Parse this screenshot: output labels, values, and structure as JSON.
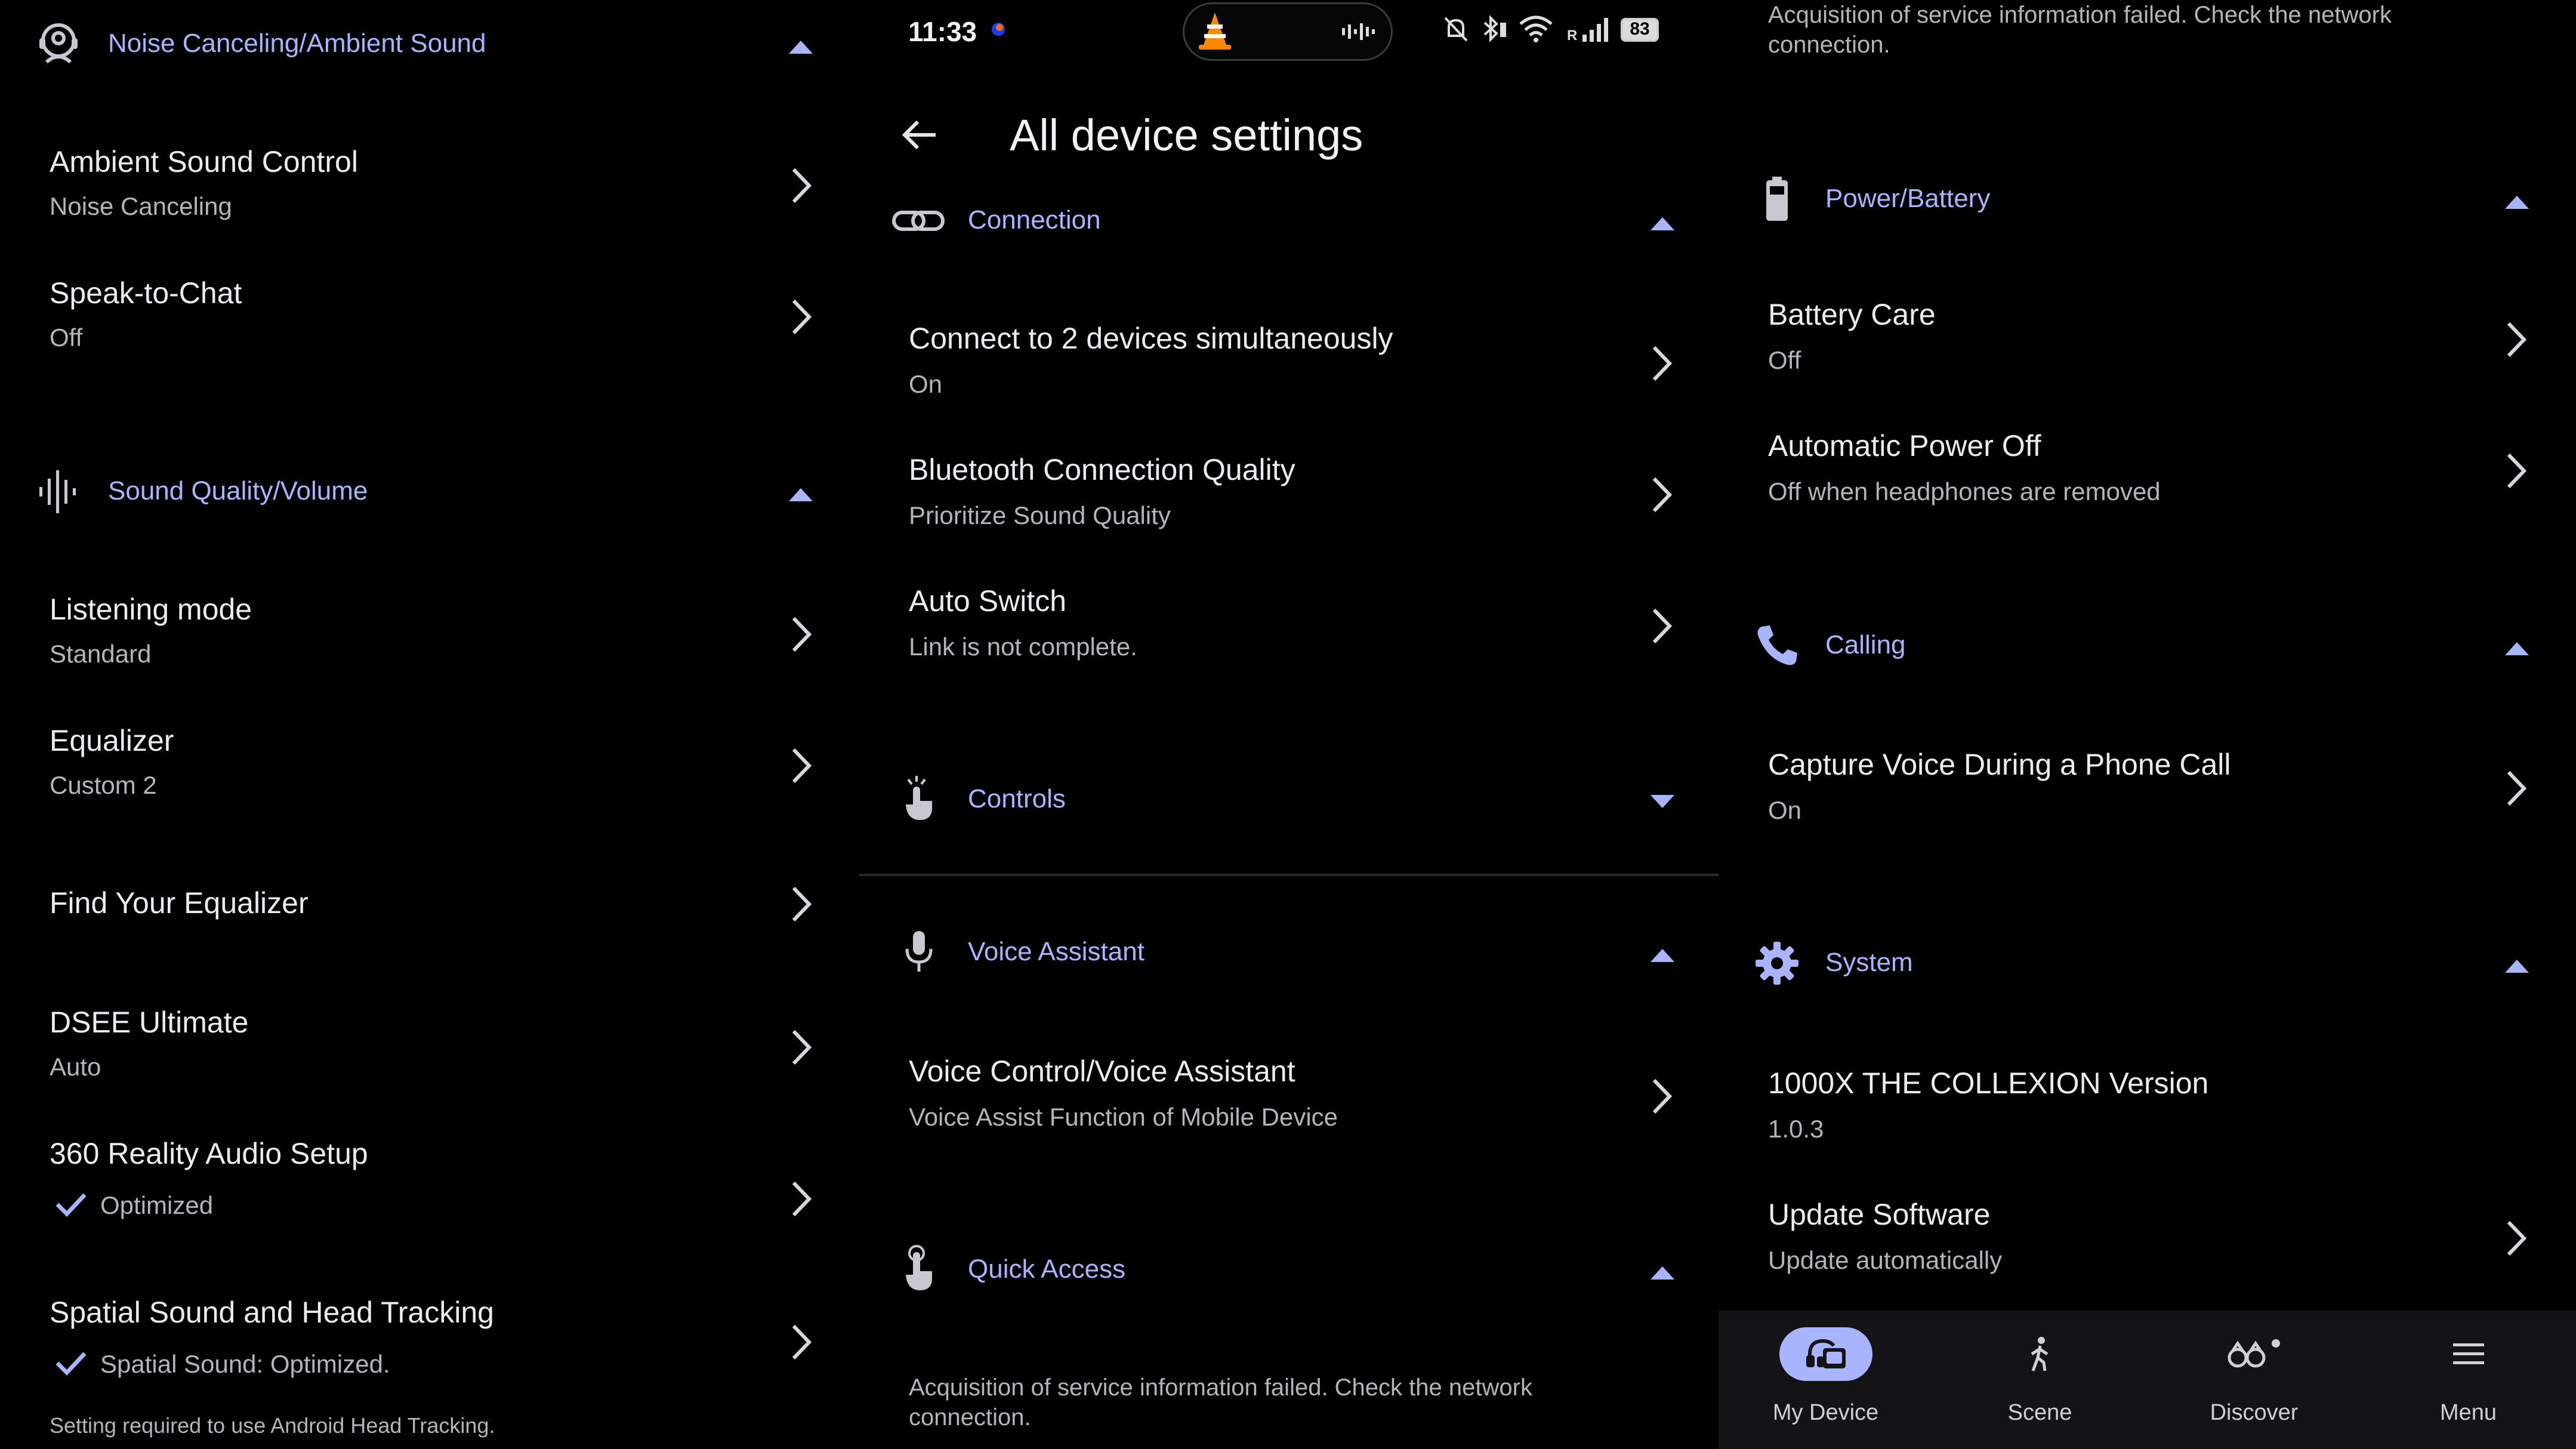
{
  "colors": {
    "accent": "#a9b4ff",
    "background": "#000000",
    "subtext": "#b4b4ba",
    "nav_background": "#141417"
  },
  "left": {
    "sections": [
      {
        "title": "Noise Canceling/Ambient Sound",
        "icon": "headphone-person-icon",
        "items": [
          {
            "title": "Ambient Sound Control",
            "subtitle": "Noise Canceling"
          },
          {
            "title": "Speak-to-Chat",
            "subtitle": "Off"
          }
        ]
      },
      {
        "title": "Sound Quality/Volume",
        "icon": "sound-wave-icon",
        "items": [
          {
            "title": "Listening mode",
            "subtitle": "Standard"
          },
          {
            "title": "Equalizer",
            "subtitle": "Custom 2"
          },
          {
            "title": "Find Your Equalizer"
          },
          {
            "title": "DSEE Ultimate",
            "subtitle": "Auto"
          },
          {
            "title": "360 Reality Audio Setup",
            "subtitle": "Optimized"
          },
          {
            "title": "Spatial Sound and Head Tracking",
            "subtitle": "Spatial Sound: Optimized.",
            "note": "Setting required to use Android Head Tracking."
          }
        ]
      }
    ]
  },
  "middle": {
    "status_bar": {
      "time": "11:33",
      "battery": "83",
      "network": "R"
    },
    "page_title": "All device settings",
    "sections": [
      {
        "title": "Connection",
        "icon": "link-icon",
        "items": [
          {
            "title": "Connect to 2 devices simultaneously",
            "subtitle": "On"
          },
          {
            "title": "Bluetooth Connection Quality",
            "subtitle": "Prioritize Sound Quality"
          },
          {
            "title": "Auto Switch",
            "subtitle": "Link is not complete."
          }
        ]
      },
      {
        "title": "Controls",
        "icon": "touch-icon",
        "items": []
      },
      {
        "title": "Voice Assistant",
        "icon": "microphone-icon",
        "items": [
          {
            "title": "Voice Control/Voice Assistant",
            "subtitle": "Voice Assist Function of Mobile Device"
          }
        ]
      },
      {
        "title": "Quick Access",
        "icon": "touch-icon",
        "note": "Acquisition of service information failed. Check the network connection."
      }
    ]
  },
  "right": {
    "top_note": "Acquisition of service information failed. Check the network connection.",
    "sections": [
      {
        "title": "Power/Battery",
        "icon": "battery-icon",
        "items": [
          {
            "title": "Battery Care",
            "subtitle": "Off"
          },
          {
            "title": "Automatic Power Off",
            "subtitle": "Off when headphones are removed"
          }
        ]
      },
      {
        "title": "Calling",
        "icon": "phone-icon",
        "items": [
          {
            "title": "Capture Voice During a Phone Call",
            "subtitle": "On"
          }
        ]
      },
      {
        "title": "System",
        "icon": "gear-icon",
        "items": [
          {
            "title": "1000X THE COLLEXION Version",
            "subtitle": "1.0.3"
          },
          {
            "title": "Update Software",
            "subtitle": "Update automatically"
          }
        ]
      }
    ],
    "bottom_nav": [
      {
        "label": "My Device",
        "icon": "headphones-device-icon",
        "active": true
      },
      {
        "label": "Scene",
        "icon": "walking-person-icon",
        "active": false
      },
      {
        "label": "Discover",
        "icon": "binoculars-icon",
        "active": false
      },
      {
        "label": "Menu",
        "icon": "hamburger-menu-icon",
        "active": false
      }
    ]
  }
}
